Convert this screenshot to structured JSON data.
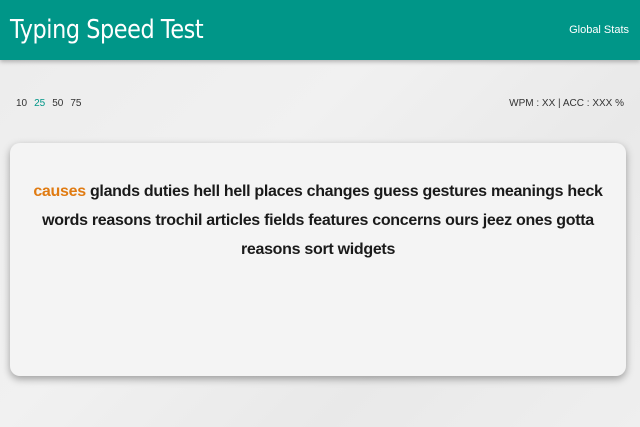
{
  "navbar": {
    "title": "Typing Speed Test",
    "global_stats_label": "Global Stats"
  },
  "toolbar": {
    "word_counts": [
      "10",
      "25",
      "50",
      "75"
    ],
    "active_word_count": "25",
    "stats_text": "WPM : XX | ACC : XXX %"
  },
  "colors": {
    "accent": "#009688",
    "current_word": "#e07b12"
  },
  "words": [
    "causes",
    "glands",
    "duties",
    "hell",
    "hell",
    "places",
    "changes",
    "guess",
    "gestures",
    "meanings",
    "heck",
    "words",
    "reasons",
    "trochil",
    "articles",
    "fields",
    "features",
    "concerns",
    "ours",
    "jeez",
    "ones",
    "gotta",
    "reasons",
    "sort",
    "widgets"
  ],
  "current_word_index": 0
}
